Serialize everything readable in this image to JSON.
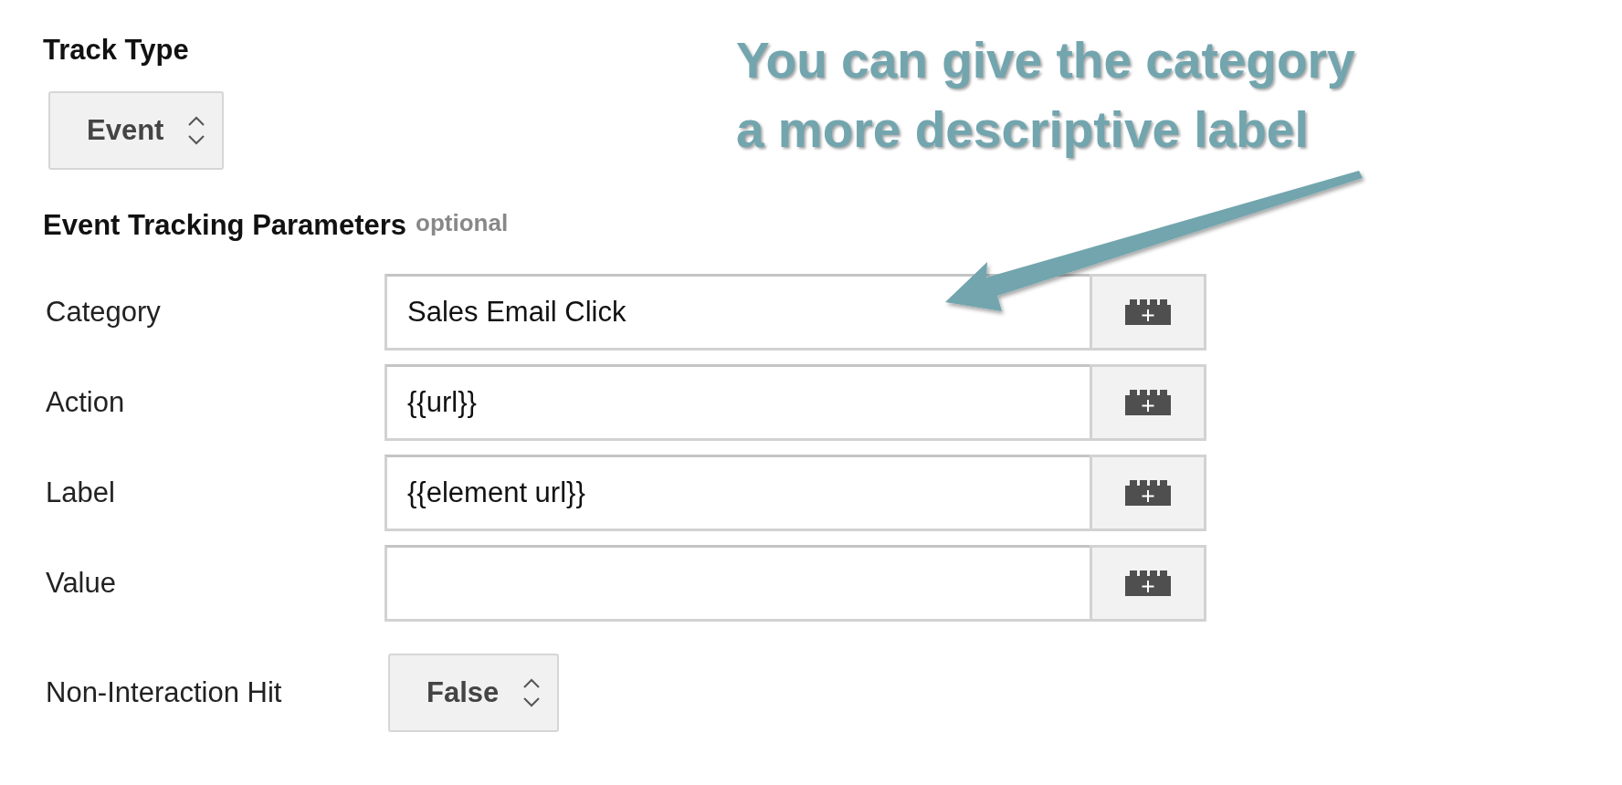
{
  "track_type": {
    "label": "Track Type",
    "select": {
      "value": "Event"
    }
  },
  "parameters": {
    "heading": "Event Tracking Parameters",
    "hint": "optional",
    "fields": [
      {
        "label": "Category",
        "value": "Sales Email Click"
      },
      {
        "label": "Action",
        "value": "{{url}}"
      },
      {
        "label": "Label",
        "value": "{{element url}}"
      },
      {
        "label": "Value"
      }
    ]
  },
  "non_interaction": {
    "label": "Non-Interaction Hit",
    "select": {
      "value": "False"
    }
  },
  "annotation": {
    "lines": [
      "You can give the category",
      "a more descriptive label"
    ]
  }
}
